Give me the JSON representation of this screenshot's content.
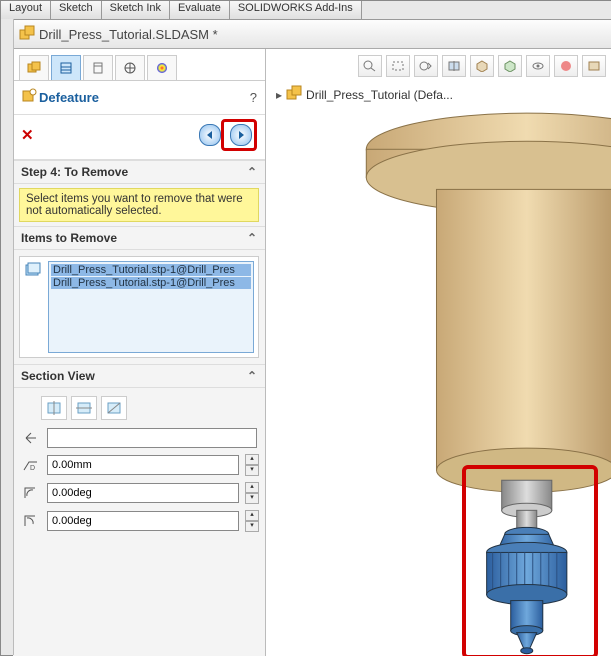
{
  "tabs": {
    "layout": "Layout",
    "sketch": "Sketch",
    "sketch_ink": "Sketch Ink",
    "evaluate": "Evaluate",
    "addins": "SOLIDWORKS Add-Ins"
  },
  "doc": {
    "title": "Drill_Press_Tutorial.SLDASM *"
  },
  "tree": {
    "root_label": "Drill_Press_Tutorial  (Defa..."
  },
  "pm": {
    "title": "Defeature",
    "help": "?",
    "step_hdr": "Step 4: To Remove",
    "hint": "Select items you want to remove that were not automatically selected.",
    "items_hdr": "Items to Remove",
    "items": [
      "Drill_Press_Tutorial.stp-1@Drill_Pres",
      "Drill_Press_Tutorial.stp-1@Drill_Pres"
    ],
    "sv_hdr": "Section View",
    "offset": "0.00mm",
    "ang1": "0.00deg",
    "ang2": "0.00deg"
  },
  "colors": {
    "accent": "#1a5f9e",
    "red": "#d20000"
  }
}
